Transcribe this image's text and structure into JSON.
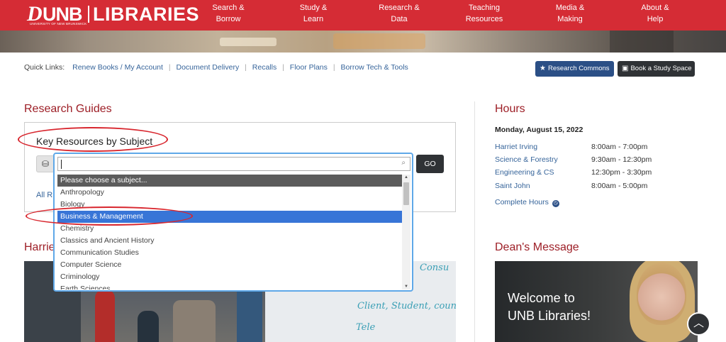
{
  "header": {
    "logo_text": "UNB",
    "logo_libraries": "LIBRARIES",
    "logo_subtext": "UNIVERSITY OF NEW BRUNSWICK",
    "nav": [
      {
        "line1": "Search &",
        "line2": "Borrow"
      },
      {
        "line1": "Study &",
        "line2": "Learn"
      },
      {
        "line1": "Research &",
        "line2": "Data"
      },
      {
        "line1": "Teaching",
        "line2": "Resources"
      },
      {
        "line1": "Media &",
        "line2": "Making"
      },
      {
        "line1": "About &",
        "line2": "Help"
      }
    ]
  },
  "quick_links": {
    "label": "Quick Links:",
    "links": [
      "Renew Books / My Account",
      "Document Delivery",
      "Recalls",
      "Floor Plans",
      "Borrow Tech & Tools"
    ],
    "separator": "|",
    "buttons": {
      "research_commons": "Research Commons",
      "book_study": "Book a Study Space"
    }
  },
  "research_guides": {
    "title": "Research Guides",
    "box_title": "Key Resources by Subject",
    "go_label": "GO",
    "all_link": "All R"
  },
  "harriet": {
    "title": "Harrie",
    "whiteboard": [
      "Consu",
      "Client, Student, counsel",
      "Tele"
    ]
  },
  "dropdown": {
    "search_value": "",
    "options": [
      "Please choose a subject...",
      "Anthropology",
      "Biology",
      "Business & Management",
      "Chemistry",
      "Classics and Ancient History",
      "Communication Studies",
      "Computer Science",
      "Criminology",
      "Earth Sciences"
    ],
    "highlighted": "Business & Management"
  },
  "hours": {
    "title": "Hours",
    "date": "Monday, August 15, 2022",
    "rows": [
      {
        "loc": "Harriet Irving",
        "time": "8:00am - 7:00pm"
      },
      {
        "loc": "Science & Forestry",
        "time": "9:30am - 12:30pm"
      },
      {
        "loc": "Engineering & CS",
        "time": "12:30pm - 3:30pm"
      },
      {
        "loc": "Saint John",
        "time": "8:00am - 5:00pm"
      }
    ],
    "complete_link": "Complete Hours"
  },
  "dean": {
    "title": "Dean's Message",
    "welcome_line1": "Welcome to",
    "welcome_line2": "UNB Libraries!"
  },
  "colors": {
    "brand_red": "#d52c35",
    "heading_red": "#9d1e26",
    "link_blue": "#36649a",
    "select_blue": "#3875d7",
    "annotation_red": "#d8262e"
  }
}
